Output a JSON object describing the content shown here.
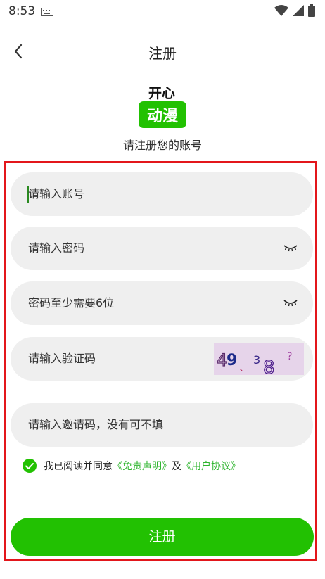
{
  "status_bar": {
    "time": "8:53"
  },
  "header": {
    "title": "注册"
  },
  "logo": {
    "line1": "开心",
    "line2": "动漫"
  },
  "subtitle": "请注册您的账号",
  "form": {
    "account_placeholder": "请输入账号",
    "password_placeholder": "请输入密码",
    "confirm_placeholder": "密码至少需要6位",
    "captcha_placeholder": "请输入验证码",
    "captcha_chars": [
      "4",
      "9",
      "、",
      "3",
      "8",
      "?"
    ],
    "invite_placeholder": "请输入邀请码，没有可不填"
  },
  "agreement": {
    "checked": true,
    "prefix": "我已阅读并同意",
    "link1": "《免责声明》",
    "middle": "及",
    "link2": "《用户协议》"
  },
  "submit_label": "注册",
  "colors": {
    "brand_green": "#22c102",
    "link_green": "#2fb52f",
    "frame_red": "#e3161b"
  },
  "icons": [
    "keyboard-icon",
    "wifi-icon",
    "signal-icon",
    "battery-icon",
    "back-arrow-icon",
    "eye-closed-icon",
    "checkmark-icon"
  ]
}
